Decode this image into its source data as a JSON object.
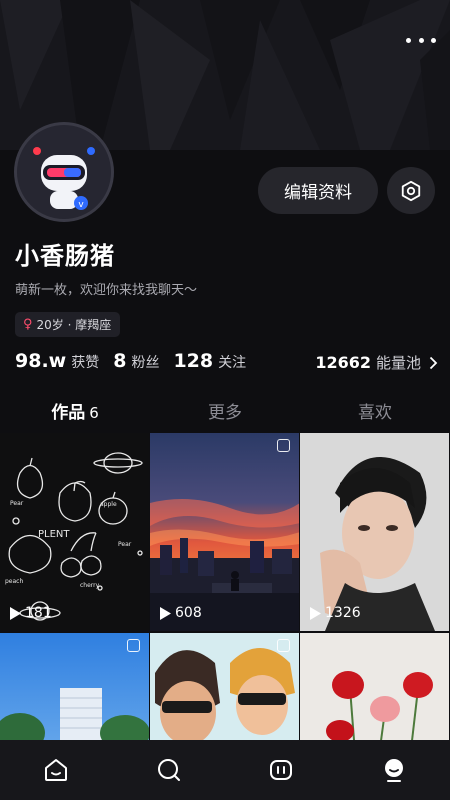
{
  "profile": {
    "name": "小香肠猪",
    "bio": "萌新一枚，欢迎你来找我聊天～",
    "tag": {
      "gender_icon": "female-icon",
      "text": "20岁 · 摩羯座"
    },
    "edit_label": "编辑资料"
  },
  "stats": {
    "likes": {
      "value": "98.w",
      "label": "获赞"
    },
    "fans": {
      "value": "8",
      "label": "粉丝"
    },
    "following": {
      "value": "128",
      "label": "关注"
    },
    "energy": {
      "value": "12662",
      "label": "能量池"
    }
  },
  "tabs": [
    {
      "label": "作品",
      "count": "6"
    },
    {
      "label": "更多"
    },
    {
      "label": "喜欢"
    }
  ],
  "posts": [
    {
      "plays": "181"
    },
    {
      "plays": "608"
    },
    {
      "plays": "1326"
    }
  ],
  "doodle_words": [
    "PLENT",
    "apple",
    "Pear",
    "Pear",
    "peach",
    "cherry"
  ],
  "colors": {
    "background": "#0e0e11",
    "button": "#26262c",
    "accent_pink": "#ff4d6d"
  },
  "nav": [
    "home-icon",
    "discover-icon",
    "messages-icon",
    "profile-icon"
  ]
}
